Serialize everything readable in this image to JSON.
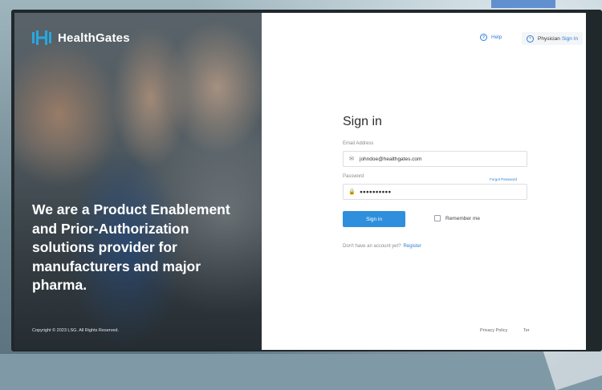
{
  "brand": {
    "name": "HealthGates",
    "accent": "#2f8fdc",
    "logo_icon": "healthgates-logo-icon"
  },
  "hero": {
    "headline": "We are a Product Enablement and Prior-Authorization solutions provider for manufacturers and major pharma.",
    "copyright": "Copyright © 2023 LSG. All Rights Reserved."
  },
  "header": {
    "help_label": "Help",
    "help_icon": "help-circle-icon",
    "physician_label": "Physician",
    "physician_link": "Sign In",
    "physician_icon": "user-circle-icon"
  },
  "form": {
    "title": "Sign in",
    "email_label": "Email Address",
    "email_value": "johndoe@healthgates.com",
    "email_icon": "mail-icon",
    "password_label": "Password",
    "password_value": "●●●●●●●●●●",
    "password_icon": "lock-icon",
    "forgot_label": "Forgot Password",
    "signin_label": "Sign in",
    "remember_label": "Remember me",
    "register_prompt": "Don't have an account yet?",
    "register_link": "Register"
  },
  "footer": {
    "privacy": "Privacy Policy",
    "terms": "Ter"
  }
}
